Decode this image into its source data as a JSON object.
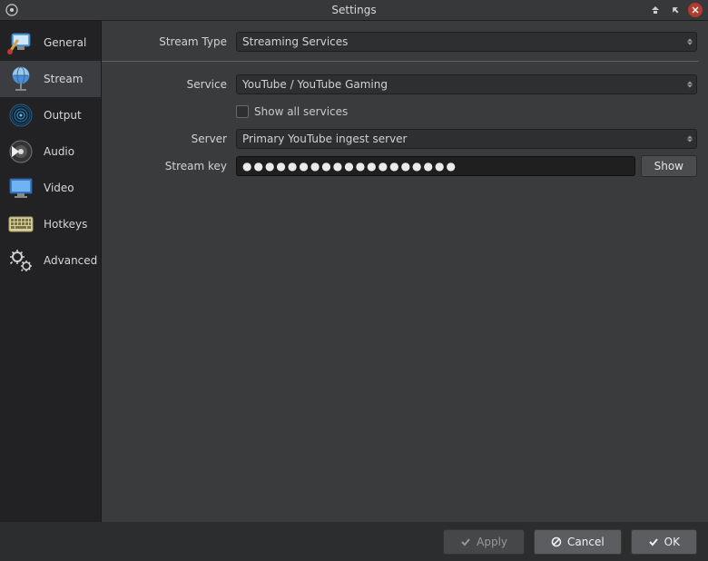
{
  "window": {
    "title": "Settings"
  },
  "sidebar": {
    "items": [
      {
        "id": "general",
        "label": "General"
      },
      {
        "id": "stream",
        "label": "Stream"
      },
      {
        "id": "output",
        "label": "Output"
      },
      {
        "id": "audio",
        "label": "Audio"
      },
      {
        "id": "video",
        "label": "Video"
      },
      {
        "id": "hotkeys",
        "label": "Hotkeys"
      },
      {
        "id": "advanced",
        "label": "Advanced"
      }
    ],
    "selected": "stream"
  },
  "form": {
    "stream_type": {
      "label": "Stream Type",
      "value": "Streaming Services"
    },
    "service": {
      "label": "Service",
      "value": "YouTube / YouTube Gaming"
    },
    "show_all_services": {
      "label": "Show all services",
      "checked": false
    },
    "server": {
      "label": "Server",
      "value": "Primary YouTube ingest server"
    },
    "stream_key": {
      "label": "Stream key",
      "masked_value": "●●●●●●●●●●●●●●●●●●●",
      "show_button": "Show"
    }
  },
  "footer": {
    "apply": "Apply",
    "cancel": "Cancel",
    "ok": "OK"
  }
}
